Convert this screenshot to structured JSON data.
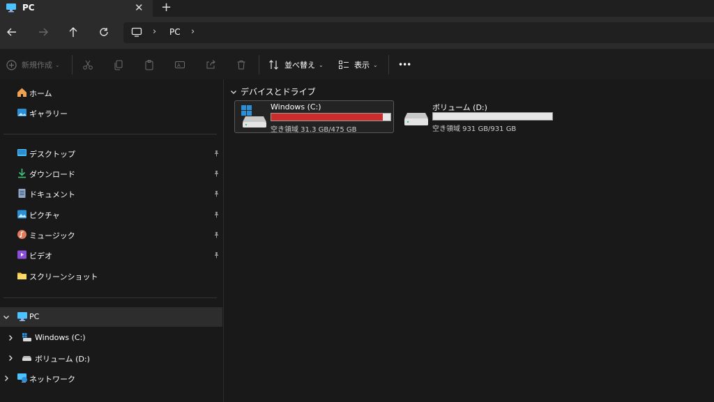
{
  "tab": {
    "title": "PC",
    "close": "✕",
    "new_tab": "+"
  },
  "address": {
    "root": "PC"
  },
  "toolbar": {
    "new_label": "新規作成",
    "sort_label": "並べ替え",
    "view_label": "表示",
    "more_label": "•••"
  },
  "sidebar": {
    "home": "ホーム",
    "gallery": "ギャラリー",
    "pinned": [
      {
        "label": "デスクトップ",
        "icon": "desktop-folder-icon"
      },
      {
        "label": "ダウンロード",
        "icon": "download-icon"
      },
      {
        "label": "ドキュメント",
        "icon": "document-icon"
      },
      {
        "label": "ピクチャ",
        "icon": "pictures-icon"
      },
      {
        "label": "ミュージック",
        "icon": "music-icon"
      },
      {
        "label": "ビデオ",
        "icon": "video-icon"
      }
    ],
    "screenshots": "スクリーンショット",
    "pc": "PC",
    "drive_c": "Windows (C:)",
    "drive_d": "ボリューム (D:)",
    "network": "ネットワーク"
  },
  "main": {
    "group_title": "デバイスとドライブ",
    "drives": [
      {
        "name": "Windows (C:)",
        "free_text": "空き領域 31.3 GB/475 GB",
        "used_fraction": 0.934,
        "color": "#cc2c2c"
      },
      {
        "name": "ボリューム (D:)",
        "free_text": "空き領域 931 GB/931 GB",
        "used_fraction": 0.0,
        "color": "#26a0da"
      }
    ]
  },
  "colors": {
    "accent": "#4cc2ff",
    "warning_bar": "#cc2c2c",
    "background": "#191919"
  }
}
